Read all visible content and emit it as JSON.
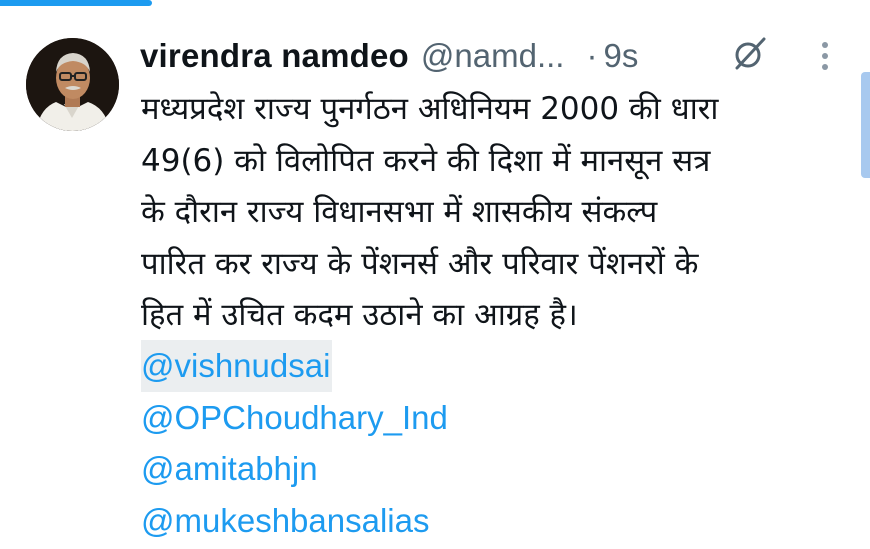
{
  "tweet": {
    "author": {
      "display_name": "virendra namdeo",
      "handle": "@namd..."
    },
    "separator": "·",
    "timestamp": "9s",
    "text_lines": [
      "मध्यप्रदेश राज्य पुनर्गठन अधिनियम 2000 की धारा",
      "49(6) को विलोपित करने की दिशा में मानसून सत्र",
      "के दौरान राज्य विधानसभा में शासकीय संकल्प",
      "पारित कर राज्य के पेंशनर्स और परिवार पेंशनरों के",
      "हित में उचित कदम उठाने का आग्रह है।"
    ],
    "mentions": [
      "@vishnudsai",
      "@OPChoudhary_Ind",
      "@amitabhjn",
      "@mukeshbansalias"
    ]
  },
  "icons": {
    "grok": "grok-icon",
    "more": "more-vertical-icon"
  },
  "colors": {
    "accent": "#1d9bf0",
    "text_primary": "#0f1419",
    "text_secondary": "#536471",
    "mention_highlight": "#ebeef0"
  }
}
